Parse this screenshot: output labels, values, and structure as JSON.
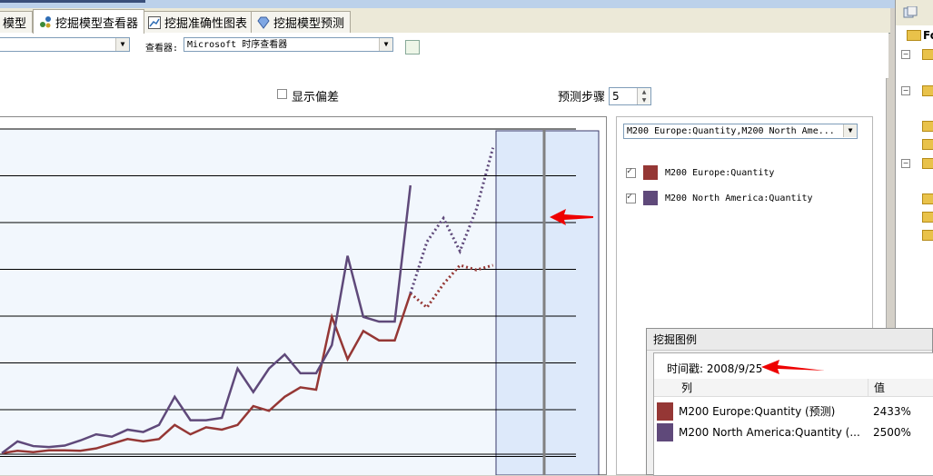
{
  "tabs": [
    {
      "label": "模型"
    },
    {
      "label": "挖掘模型查看器",
      "active": true
    },
    {
      "label": "挖掘准确性图表"
    },
    {
      "label": "挖掘模型预测"
    }
  ],
  "toolbar": {
    "viewer_label": "查看器:",
    "viewer_value": "Microsoft 时序查看器",
    "model_value": ""
  },
  "controls": {
    "show_deviation_label": "显示偏差",
    "predict_steps_label": "预测步骤",
    "predict_steps_value": "5"
  },
  "series_panel": {
    "selector_value": "M200 Europe:Quantity,M200 North Ame...",
    "items": [
      {
        "label": "M200 Europe:Quantity",
        "color": "#953735",
        "checked": true
      },
      {
        "label": "M200 North America:Quantity",
        "color": "#5f497a",
        "checked": true
      }
    ]
  },
  "tree": {
    "header_text": "Fo"
  },
  "mining_legend": {
    "title": "挖掘图例",
    "timestamp": "时间戳: 2008/9/25",
    "col_header": "列",
    "val_header": "值",
    "rows": [
      {
        "label": "M200 Europe:Quantity (预测)",
        "value": "2433%",
        "color": "#953735"
      },
      {
        "label": "M200 North America:Quantity (...",
        "value": "2500%",
        "color": "#5f497a"
      }
    ]
  },
  "chart_data": {
    "type": "line",
    "title": "",
    "xlabel": "",
    "ylabel": "",
    "grid": true,
    "x_index": [
      0,
      1,
      2,
      3,
      4,
      5,
      6,
      7,
      8,
      9,
      10,
      11,
      12,
      13,
      14,
      15,
      16,
      17,
      18,
      19,
      20,
      21,
      22,
      23,
      24,
      25,
      26,
      27,
      28,
      29,
      30
    ],
    "forecast_start_index": 24,
    "series": [
      {
        "name": "M200 Europe:Quantity",
        "color": "#953735",
        "historical": [
          1,
          1.5,
          1.2,
          1.6,
          1.6,
          1.5,
          2,
          3,
          4,
          3.5,
          4,
          7,
          5,
          6.5,
          6,
          7,
          11,
          10,
          13,
          15,
          14.5,
          30,
          21,
          27,
          25,
          25,
          35
        ],
        "forecast": [
          35,
          32,
          37,
          41,
          40,
          41
        ]
      },
      {
        "name": "M200 North America:Quantity",
        "color": "#5f497a",
        "historical": [
          1,
          3.5,
          2.5,
          2.3,
          2.6,
          3.7,
          5,
          4.5,
          6,
          5.5,
          7,
          13,
          8,
          8,
          8.5,
          19,
          14,
          19,
          22,
          18,
          18,
          24,
          43,
          30,
          29,
          29,
          58
        ],
        "forecast": [
          35,
          46,
          51,
          44,
          53,
          66
        ]
      }
    ]
  }
}
